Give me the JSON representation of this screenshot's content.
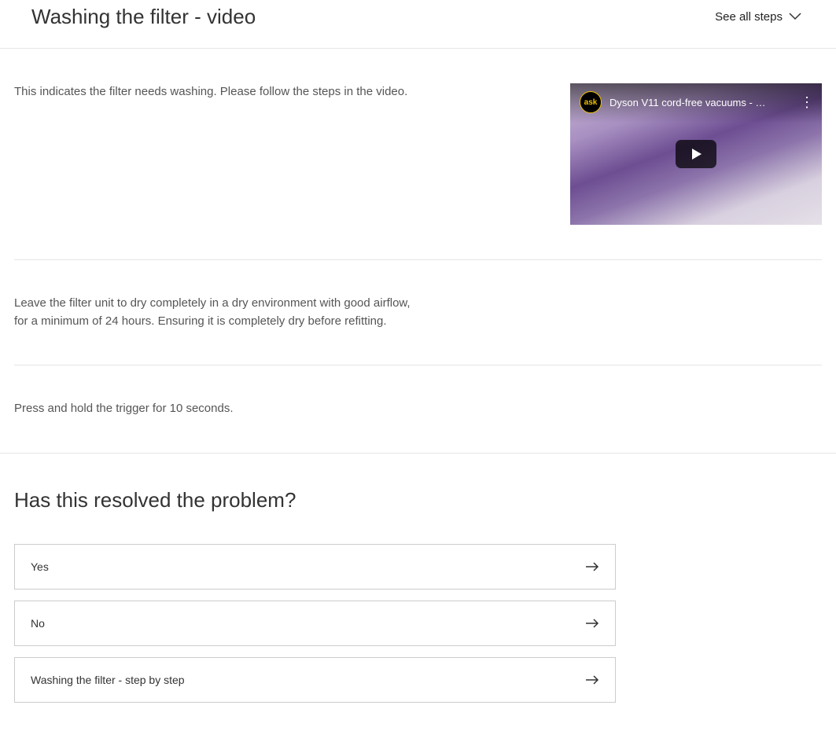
{
  "header": {
    "title": "Washing the filter - video",
    "see_all_label": "See all steps"
  },
  "steps": {
    "step1_text": "This indicates the filter needs washing. Please follow the steps in the video.",
    "step2_text": "Leave the filter unit to dry completely in a dry environment with good airflow, for a minimum of 24 hours. Ensuring it is completely dry before refitting.",
    "step3_text": "Press and hold the trigger for 10 seconds."
  },
  "video": {
    "channel_badge": "ask",
    "title": "Dyson V11 cord-free vacuums - …"
  },
  "resolution": {
    "heading": "Has this resolved the problem?",
    "options": [
      {
        "label": "Yes"
      },
      {
        "label": "No"
      },
      {
        "label": "Washing the filter - step by step"
      }
    ]
  }
}
